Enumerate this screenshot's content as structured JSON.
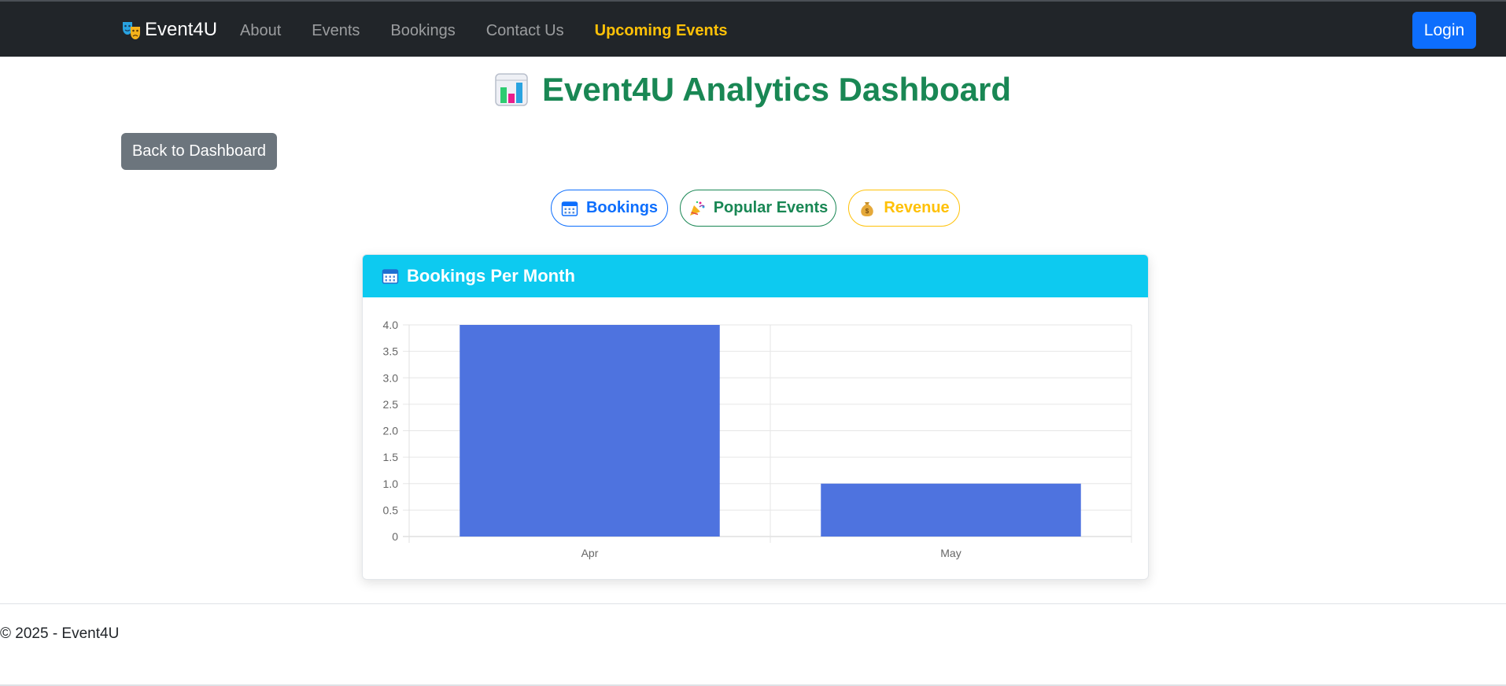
{
  "navbar": {
    "brand": "Event4U",
    "links": [
      "About",
      "Events",
      "Bookings",
      "Contact Us"
    ],
    "highlight_link": "Upcoming Events",
    "login_label": "Login"
  },
  "page": {
    "title": "Event4U Analytics Dashboard",
    "back_label": "Back to Dashboard"
  },
  "tabs": {
    "bookings": "Bookings",
    "popular": "Popular Events",
    "revenue": "Revenue"
  },
  "card": {
    "title": "Bookings Per Month"
  },
  "chart_data": {
    "type": "bar",
    "title": "Bookings Per Month",
    "categories": [
      "Apr",
      "May"
    ],
    "values": [
      4,
      1
    ],
    "ylim": [
      0,
      4
    ],
    "yticks": [
      "0",
      "0.5",
      "1.0",
      "1.5",
      "2.0",
      "2.5",
      "3.0",
      "3.5",
      "4.0"
    ],
    "xlabel": "",
    "ylabel": "",
    "grid": true,
    "bar_color": "#4e73df"
  },
  "footer": {
    "text": "© 2025 - Event4U"
  },
  "colors": {
    "navbar_bg": "#212529",
    "primary": "#0d6efd",
    "success": "#198754",
    "warning": "#ffc107",
    "info": "#0dcaf0",
    "secondary": "#6c757d"
  },
  "icons": {
    "brand": "theater-masks-icon",
    "title": "bar-chart-icon",
    "bookings": "calendar-icon",
    "popular": "party-popper-icon",
    "revenue": "money-bag-icon",
    "card": "calendar-icon"
  }
}
